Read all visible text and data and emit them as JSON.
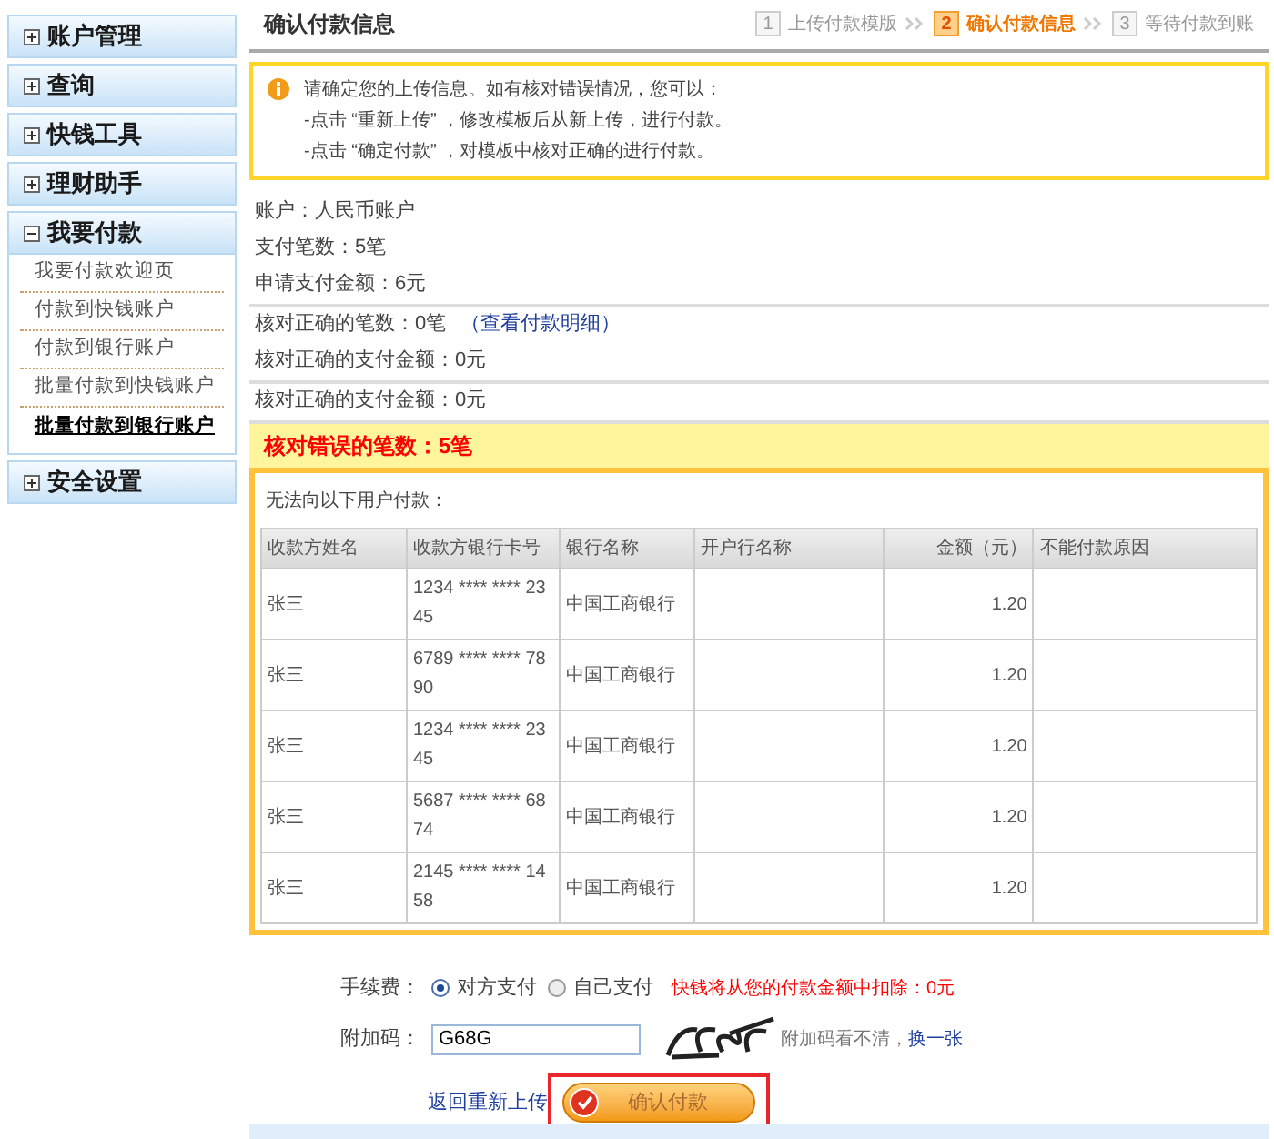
{
  "sidebar": {
    "groups": [
      {
        "label": "账户管理",
        "expanded": false
      },
      {
        "label": "查询",
        "expanded": false
      },
      {
        "label": "快钱工具",
        "expanded": false
      },
      {
        "label": "理财助手",
        "expanded": false
      },
      {
        "label": "我要付款",
        "expanded": true,
        "children": [
          {
            "label": "我要付款欢迎页",
            "selected": false
          },
          {
            "label": "付款到快钱账户",
            "selected": false
          },
          {
            "label": "付款到银行账户",
            "selected": false
          },
          {
            "label": "批量付款到快钱账户",
            "selected": false
          },
          {
            "label": "批量付款到银行账户",
            "selected": true
          }
        ]
      },
      {
        "label": "安全设置",
        "expanded": false
      }
    ]
  },
  "page_title": "确认付款信息",
  "steps": [
    {
      "number": "1",
      "label": "上传付款模版",
      "selected": false
    },
    {
      "number": "2",
      "label": "确认付款信息",
      "selected": true
    },
    {
      "number": "3",
      "label": "等待付款到账",
      "selected": false
    }
  ],
  "notice": {
    "lines": [
      "请确定您的上传信息。如有核对错误情况，您可以：",
      "-点击 “重新上传” ，修改模板后从新上传，进行付款。",
      "-点击 “确定付款” ，对模板中核对正确的进行付款。"
    ]
  },
  "summary_groups": [
    [
      {
        "text": "账户：人民币账户"
      },
      {
        "text": "支付笔数：5笔"
      },
      {
        "text": "申请支付金额：6元"
      }
    ],
    [
      {
        "text": "核对正确的笔数：0笔",
        "link": "（查看付款明细）"
      },
      {
        "text": "核对正确的支付金额：0元"
      }
    ],
    [
      {
        "text": "核对正确的支付金额：0元"
      }
    ]
  ],
  "error_banner": "核对错误的笔数：5笔",
  "error_table": {
    "caption": "无法向以下用户付款：",
    "columns": [
      "收款方姓名",
      "收款方银行卡号",
      "银行名称",
      "开户行名称",
      "金额（元）",
      "不能付款原因"
    ],
    "rows": [
      [
        "张三",
        "1234 **** **** 2345",
        "中国工商银行",
        "",
        "1.20",
        ""
      ],
      [
        "张三",
        "6789 **** **** 7890",
        "中国工商银行",
        "",
        "1.20",
        ""
      ],
      [
        "张三",
        "1234 **** **** 2345",
        "中国工商银行",
        "",
        "1.20",
        ""
      ],
      [
        "张三",
        "5687 **** **** 6874",
        "中国工商银行",
        "",
        "1.20",
        ""
      ],
      [
        "张三",
        "2145 **** **** 1458",
        "中国工商银行",
        "",
        "1.20",
        ""
      ]
    ]
  },
  "fee": {
    "label": "手续费：",
    "options": [
      {
        "label": "对方支付",
        "selected": true
      },
      {
        "label": "自己支付",
        "selected": false
      }
    ],
    "note": "快钱将从您的付款金额中扣除：0元"
  },
  "captcha": {
    "label": "附加码：",
    "value": "G68G",
    "hint": "附加码看不清，",
    "refresh_link": "换一张"
  },
  "back_link": "返回重新上传",
  "confirm_button": "确认付款"
}
